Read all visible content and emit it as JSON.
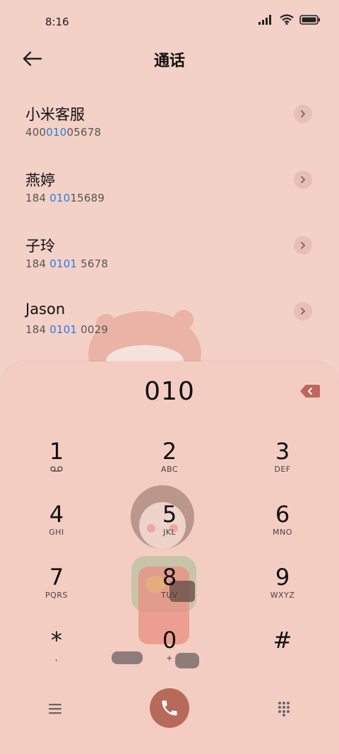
{
  "status": {
    "time": "8:16"
  },
  "header": {
    "title": "通话"
  },
  "contacts": [
    {
      "name": "小米客服",
      "num_pre": "400",
      "num_hl": "010",
      "num_post": "05678"
    },
    {
      "name": "燕婷",
      "num_pre": "184 ",
      "num_hl": "010",
      "num_post": "15689"
    },
    {
      "name": "子玲",
      "num_pre": "184 ",
      "num_hl": "0101",
      "num_post": " 5678"
    },
    {
      "name": "Jason",
      "num_pre": "184 ",
      "num_hl": "0101",
      "num_post": " 0029"
    }
  ],
  "dialer": {
    "number": "010",
    "keys": [
      {
        "digit": "1",
        "letters": ""
      },
      {
        "digit": "2",
        "letters": "ABC"
      },
      {
        "digit": "3",
        "letters": "DEF"
      },
      {
        "digit": "4",
        "letters": "GHI"
      },
      {
        "digit": "5",
        "letters": "JKL"
      },
      {
        "digit": "6",
        "letters": "MNO"
      },
      {
        "digit": "7",
        "letters": "PQRS"
      },
      {
        "digit": "8",
        "letters": "TUV"
      },
      {
        "digit": "9",
        "letters": "WXYZ"
      },
      {
        "digit": "*",
        "letters": ","
      },
      {
        "digit": "0",
        "letters": "+"
      },
      {
        "digit": "#",
        "letters": ""
      }
    ]
  },
  "colors": {
    "background": "#f3d1c6",
    "highlight": "#2a7be4",
    "call_button": "#b86a5a",
    "backspace": "#c0665a"
  }
}
